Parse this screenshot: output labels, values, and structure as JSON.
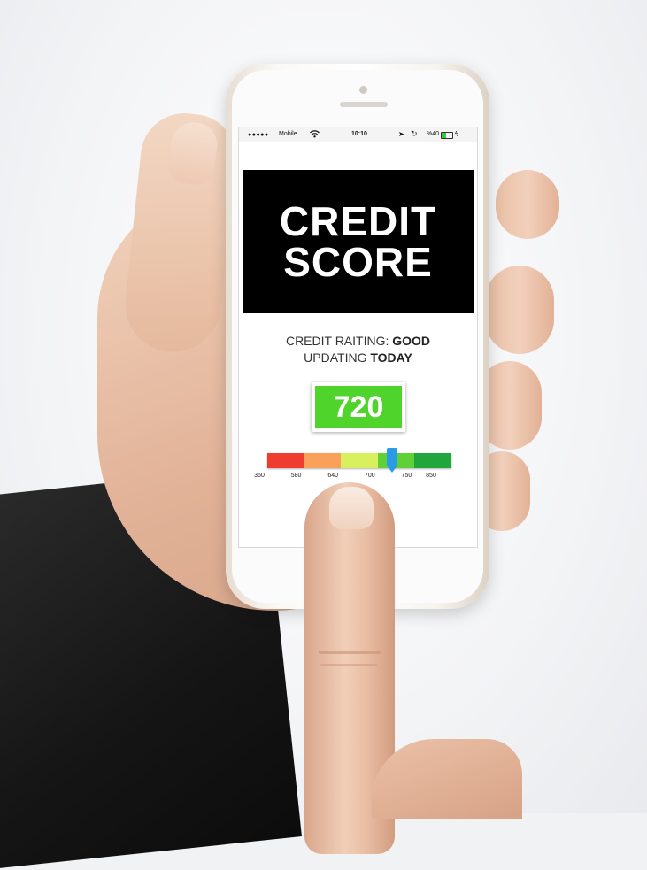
{
  "statusbar": {
    "signal": "●●●●●",
    "carrier": "Mobile",
    "time": "10:10",
    "battery_text": "%40",
    "battery_level": 0.4,
    "battery_color": "#3ec640",
    "icons": [
      "wifi-icon",
      "location-arrow-icon",
      "rotation-lock-icon",
      "battery-icon",
      "charging-bolt-icon"
    ]
  },
  "banner": {
    "line1": "CREDIT",
    "line2": "SCORE"
  },
  "rating": {
    "label": "CREDIT RAITING:",
    "value": "GOOD",
    "update_label": "UPDATING",
    "update_value": "TODAY"
  },
  "score": {
    "value": "720",
    "color": "#4ed42a"
  },
  "gauge": {
    "segments": [
      {
        "from": 360,
        "to": 580,
        "color": "#f03c2e"
      },
      {
        "from": 580,
        "to": 640,
        "color": "#f9a05a"
      },
      {
        "from": 640,
        "to": 700,
        "color": "#d8f05e"
      },
      {
        "from": 700,
        "to": 750,
        "color": "#5fd136"
      },
      {
        "from": 750,
        "to": 850,
        "color": "#21a63b"
      }
    ],
    "ticks": [
      "360",
      "580",
      "640",
      "700",
      "750",
      "850"
    ],
    "marker_color": "#2b9be8",
    "marker_value": 720
  }
}
